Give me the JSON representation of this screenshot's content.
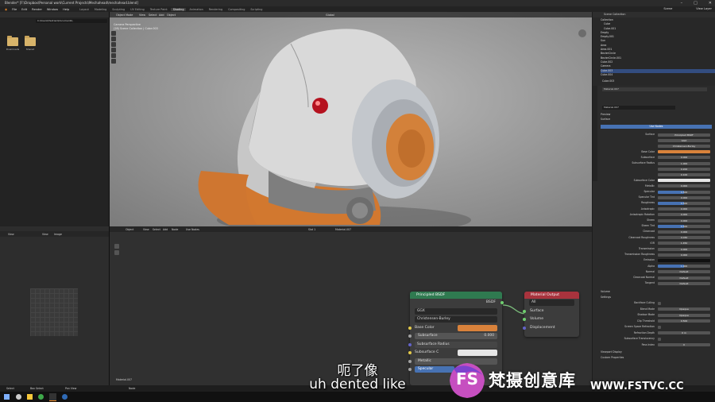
{
  "window": {
    "title": "Blender* [F:\\Dropbox\\Personal work\\Current Projects\\Mechahead\\mechahead.blend]"
  },
  "menu": {
    "items": [
      "File",
      "Edit",
      "Render",
      "Window",
      "Help"
    ],
    "workspaces": [
      "Layout",
      "Modeling",
      "Sculpting",
      "UV Editing",
      "Texture Paint",
      "Shading",
      "Animation",
      "Rendering",
      "Compositing",
      "Scripting"
    ],
    "active_workspace": "Shading",
    "scene": "Scene",
    "view_layer": "View Layer"
  },
  "file_browser": {
    "path": "C:\\Users\\Hadrien\\Documents\\",
    "folders": [
      "Downloads",
      "Shared"
    ]
  },
  "viewport": {
    "mode": "Object Mode",
    "menus": [
      "View",
      "Select",
      "Add",
      "Object"
    ],
    "info_line1": "Camera Perspective",
    "info_line2": "(28) Scene Collection | Cube.003",
    "shading": "Global"
  },
  "outliner": {
    "title": "Scene Collection",
    "rows": [
      "Collection",
      "Cube",
      "Cube.001",
      "Empty",
      "Empty.001",
      "Sun",
      "Area",
      "Area.001",
      "BezierCircle",
      "BezierCircle.001",
      "Cube.002",
      "Camera",
      "Cube.003",
      "Cube.004"
    ]
  },
  "properties": {
    "object": "Cube.003",
    "material": "Material.007",
    "sections": [
      "Preview",
      "Surface",
      "Volume",
      "Settings",
      "Viewport Display",
      "Custom Properties"
    ],
    "use_nodes": "Use Nodes",
    "rows": [
      {
        "label": "Surface",
        "value": "Principled BSDF"
      },
      {
        "label": "",
        "value": "GGX"
      },
      {
        "label": "",
        "value": "Christensen-Burley"
      },
      {
        "label": "Base Color",
        "value": ""
      },
      {
        "label": "Subsurface",
        "value": "0.000"
      },
      {
        "label": "Subsurface Radius",
        "value": "1.000"
      },
      {
        "label": "",
        "value": "0.200"
      },
      {
        "label": "",
        "value": "0.100"
      },
      {
        "label": "Subsurface Color",
        "value": ""
      },
      {
        "label": "Metallic",
        "value": "0.000"
      },
      {
        "label": "Specular",
        "value": "0.500"
      },
      {
        "label": "Specular Tint",
        "value": "0.000"
      },
      {
        "label": "Roughness",
        "value": "0.500"
      },
      {
        "label": "Anisotropic",
        "value": "0.000"
      },
      {
        "label": "Anisotropic Rotation",
        "value": "0.000"
      },
      {
        "label": "Sheen",
        "value": "0.000"
      },
      {
        "label": "Sheen Tint",
        "value": "0.500"
      },
      {
        "label": "Clearcoat",
        "value": "0.000"
      },
      {
        "label": "Clearcoat Roughness",
        "value": "0.030"
      },
      {
        "label": "IOR",
        "value": "1.450"
      },
      {
        "label": "Transmission",
        "value": "0.000"
      },
      {
        "label": "Transmission Roughness",
        "value": "0.000"
      },
      {
        "label": "Emission",
        "value": ""
      },
      {
        "label": "Alpha",
        "value": "1.000"
      },
      {
        "label": "Normal",
        "value": "Default"
      },
      {
        "label": "Clearcoat Normal",
        "value": "Default"
      },
      {
        "label": "Tangent",
        "value": "Default"
      }
    ],
    "settings": [
      {
        "label": "Backface Culling",
        "value": ""
      },
      {
        "label": "Blend Mode",
        "value": "Opaque"
      },
      {
        "label": "Shadow Mode",
        "value": "Opaque"
      },
      {
        "label": "Clip Threshold",
        "value": "0.500"
      },
      {
        "label": "Screen Space Refraction",
        "value": ""
      },
      {
        "label": "Refraction Depth",
        "value": "0 m"
      },
      {
        "label": "Subsurface Translucency",
        "value": ""
      },
      {
        "label": "Pass Index",
        "value": "0"
      }
    ]
  },
  "node_editor": {
    "menus": [
      "Object",
      "View",
      "Select",
      "Add",
      "Node",
      "Use Nodes"
    ],
    "slot": "Slot 1",
    "material": "Material.007",
    "footer": "Material.007",
    "bsdf_node": {
      "title": "Principled BSDF",
      "output": "BSDF",
      "distribution": "GGX",
      "subsurface_method": "Christensen-Burley",
      "rows": [
        {
          "label": "Base Color",
          "value": ""
        },
        {
          "label": "Subsurface",
          "value": "0.000"
        },
        {
          "label": "Subsurface Radius",
          "value": ""
        },
        {
          "label": "Subsurface C",
          "value": ""
        },
        {
          "label": "Metallic",
          "value": ""
        },
        {
          "label": "Specular",
          "value": ""
        }
      ]
    },
    "output_node": {
      "title": "Material Output",
      "target": "All",
      "inputs": [
        "Surface",
        "Volume",
        "Displacement"
      ]
    }
  },
  "image_editor": {
    "menus": [
      "View",
      "View",
      "Image"
    ]
  },
  "statusbar": {
    "items": [
      "Select",
      "Box Select",
      "Pan View",
      "Node"
    ]
  },
  "subtitle": {
    "chinese": "呃了像",
    "english": "uh dented like"
  },
  "watermark": {
    "logo": "FS",
    "text": "梵摄创意库",
    "url": "WWW.FSTVC.CC"
  },
  "colors": {
    "accent_blue": "#4772b3",
    "orange": "#d9823b",
    "node_green": "#2f7a50",
    "node_red": "#a8333d"
  }
}
